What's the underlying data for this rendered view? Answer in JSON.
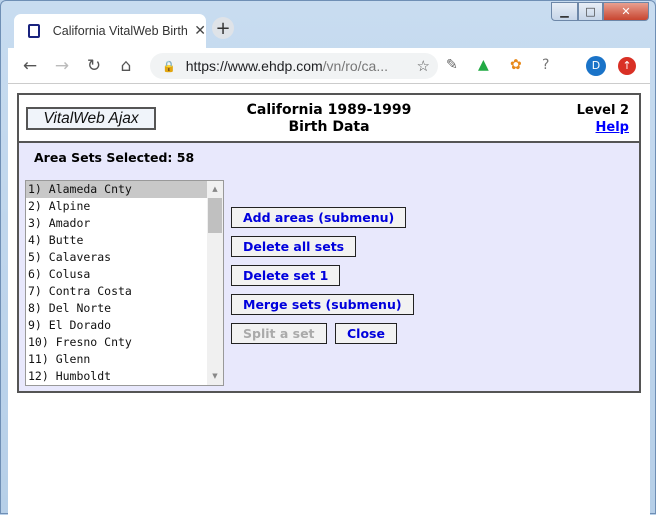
{
  "browser": {
    "tab_title": "California VitalWeb Birth Data - M",
    "url_host": "https://www.ehdp.com",
    "url_path": "/vn/ro/ca...",
    "profile_initial": "D"
  },
  "header": {
    "logo_button": "VitalWeb Ajax",
    "title_line1": "California 1989-1999",
    "title_line2": "Birth Data",
    "level": "Level 2",
    "help": "Help"
  },
  "main": {
    "sets_selected": "Area Sets Selected: 58",
    "areas": [
      "1) Alameda Cnty",
      "2) Alpine",
      "3) Amador",
      "4) Butte",
      "5) Calaveras",
      "6) Colusa",
      "7) Contra Costa",
      "8) Del Norte",
      "9) El Dorado",
      "10) Fresno Cnty",
      "11) Glenn",
      "12) Humboldt"
    ],
    "selected_index": 0,
    "buttons": {
      "add": "Add areas (submenu)",
      "delete_all": "Delete all sets",
      "delete_one": "Delete set 1",
      "merge": "Merge sets (submenu)",
      "split": "Split a set",
      "close": "Close"
    }
  },
  "colors": {
    "panel_bg": "#e8e8fc",
    "button_text": "#0000dd",
    "disabled_text": "#aaaaaa"
  }
}
